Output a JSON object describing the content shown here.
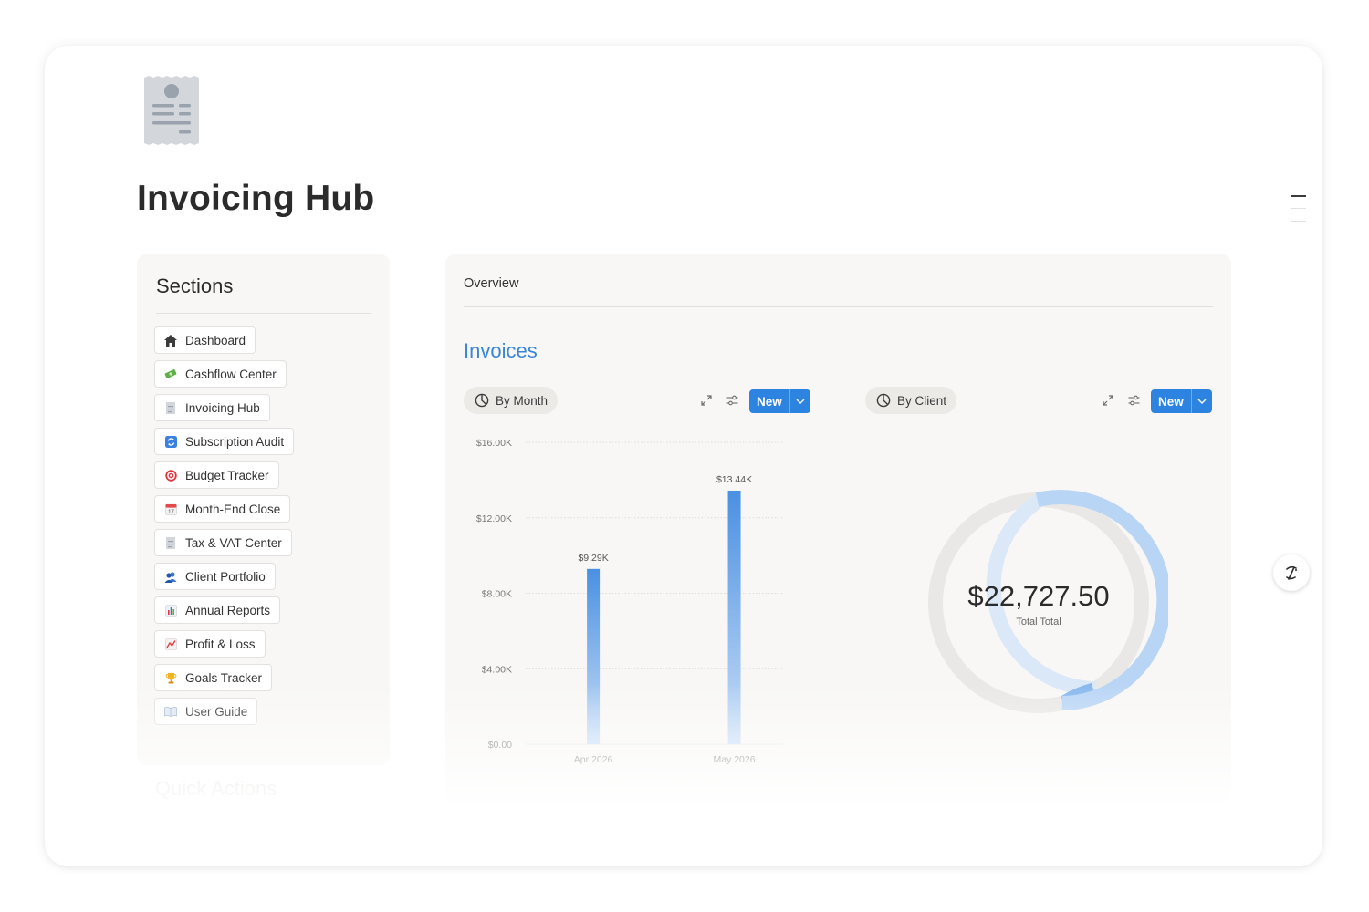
{
  "page": {
    "title": "Invoicing Hub",
    "icon": "receipt-icon"
  },
  "sections": {
    "title": "Sections",
    "items": [
      {
        "label": "Dashboard",
        "icon": "house-icon"
      },
      {
        "label": "Cashflow Center",
        "icon": "money-icon"
      },
      {
        "label": "Invoicing Hub",
        "icon": "receipt-icon"
      },
      {
        "label": "Subscription Audit",
        "icon": "refresh-icon"
      },
      {
        "label": "Budget Tracker",
        "icon": "target-icon"
      },
      {
        "label": "Month-End Close",
        "icon": "calendar-icon"
      },
      {
        "label": "Tax & VAT Center",
        "icon": "receipt-icon"
      },
      {
        "label": "Client Portfolio",
        "icon": "people-icon"
      },
      {
        "label": "Annual Reports",
        "icon": "bar-chart-icon"
      },
      {
        "label": "Profit & Loss",
        "icon": "trend-chart-icon"
      },
      {
        "label": "Goals Tracker",
        "icon": "trophy-icon"
      },
      {
        "label": "User Guide",
        "icon": "book-icon"
      }
    ]
  },
  "quick_actions": {
    "title": "Quick Actions"
  },
  "overview": {
    "label": "Overview",
    "heading": "Invoices",
    "views": [
      {
        "label": "By Month",
        "new_label": "New"
      },
      {
        "label": "By Client",
        "new_label": "New"
      }
    ]
  },
  "colors": {
    "accent": "#2d83e0",
    "heading_blue": "#3a86d6",
    "bar_top": "#4a90e2",
    "bar_bottom": "#c9def7",
    "donut_light": "#dbe8f8",
    "donut_mid": "#b9d5f5",
    "donut_strong": "#8ab8ee",
    "donut_track": "#e9e8e6"
  },
  "chart_data": [
    {
      "type": "bar",
      "categories": [
        "Apr 2026",
        "May 2026"
      ],
      "values": [
        9290,
        13440
      ],
      "data_labels": [
        "$9.29K",
        "$13.44K"
      ],
      "ylim": [
        0,
        16000
      ],
      "y_ticks": [
        0,
        4000,
        8000,
        12000,
        16000
      ],
      "y_tick_labels": [
        "$0.00",
        "$4.00K",
        "$8.00K",
        "$12.00K",
        "$16.00K"
      ],
      "grid": true
    },
    {
      "type": "pie",
      "style": "donut",
      "center_value": "$22,727.50",
      "center_label": "Total Total",
      "slices": [
        {
          "value": 9290,
          "color": "#dbe8f8"
        },
        {
          "value": 1200,
          "color": "#8ab8ee"
        },
        {
          "value": 12237.5,
          "color": "#b9d5f5"
        }
      ]
    }
  ]
}
